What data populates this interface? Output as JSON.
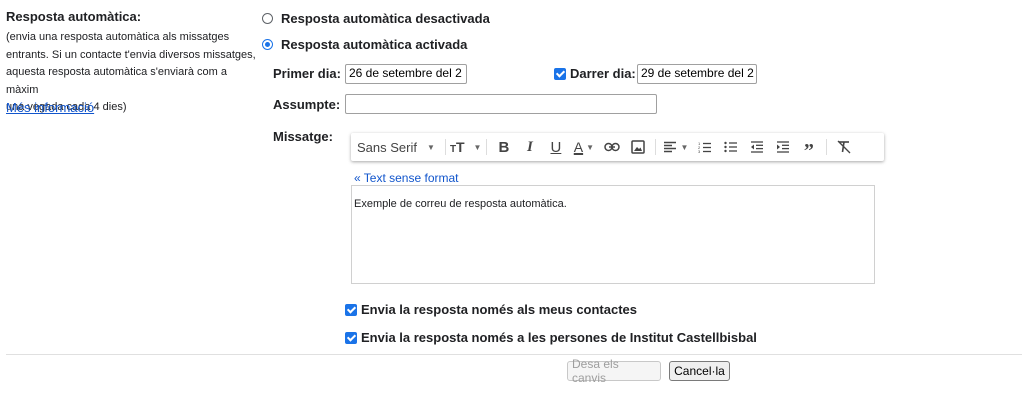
{
  "left": {
    "title": "Resposta automàtica:",
    "description_lines": [
      "(envia una resposta automàtica als missatges",
      "entrants. Si un contacte t'envia diversos missatges,",
      "aquesta resposta automàtica s'enviarà com a màxim",
      "una vegada cada 4 dies)"
    ],
    "more_info": "Més informació"
  },
  "options": {
    "off_label": "Resposta automàtica desactivada",
    "on_label": "Resposta automàtica activada",
    "selected": "on"
  },
  "dates": {
    "first_day_label": "Primer dia:",
    "first_day_value": "26 de setembre del 2",
    "last_day_label": "Darrer dia:",
    "last_day_value": "29 de setembre del 2",
    "last_day_checked": true
  },
  "subject": {
    "label": "Assumpte:",
    "value": ""
  },
  "message": {
    "label": "Missatge:",
    "toolbar": {
      "font": "Sans Serif",
      "icons": [
        "font-size-icon",
        "bold-icon",
        "italic-icon",
        "underline-icon",
        "text-color-icon",
        "link-icon",
        "image-icon",
        "align-icon",
        "numbered-list-icon",
        "bulleted-list-icon",
        "indent-less-icon",
        "indent-more-icon",
        "quote-icon",
        "remove-formatting-icon"
      ]
    },
    "plain_text_link": "« Text sense format",
    "body": "Exemple de correu de resposta automàtica."
  },
  "checkboxes": {
    "contacts_only": "Envia la resposta només als meus contactes",
    "org_only": "Envia la resposta només a les persones de Institut Castellbisbal"
  },
  "buttons": {
    "save": "Desa els canvis",
    "cancel": "Cancel·la"
  },
  "colors": {
    "accent": "#1a73e8",
    "link": "#1155cc"
  }
}
